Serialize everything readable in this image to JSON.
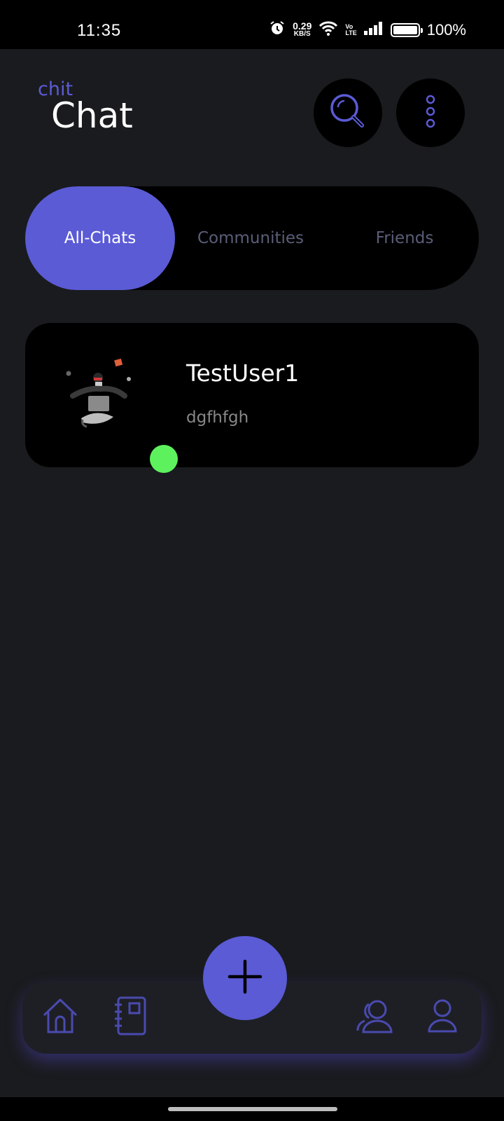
{
  "status_bar": {
    "time": "11:35",
    "net_speed_value": "0.29",
    "net_speed_unit": "KB/S",
    "volte_top": "Vo",
    "volte_bottom": "LTE",
    "battery": "100%"
  },
  "header": {
    "logo_small": "chit",
    "logo_big": "Chat"
  },
  "tabs": [
    {
      "label": "All-Chats",
      "active": true
    },
    {
      "label": "Communities",
      "active": false
    },
    {
      "label": "Friends",
      "active": false
    }
  ],
  "chats": [
    {
      "name": "TestUser1",
      "last_message": "dgfhfgh",
      "online": true
    }
  ],
  "colors": {
    "accent": "#5b5bd6",
    "background": "#1a1b1e",
    "card": "#000000",
    "online": "#5ef15e"
  },
  "icons": {
    "search": "search-icon",
    "menu": "more-vertical-icon",
    "home": "home-icon",
    "book": "notebook-icon",
    "friends": "friends-icon",
    "profile": "profile-icon",
    "add": "plus-icon"
  }
}
